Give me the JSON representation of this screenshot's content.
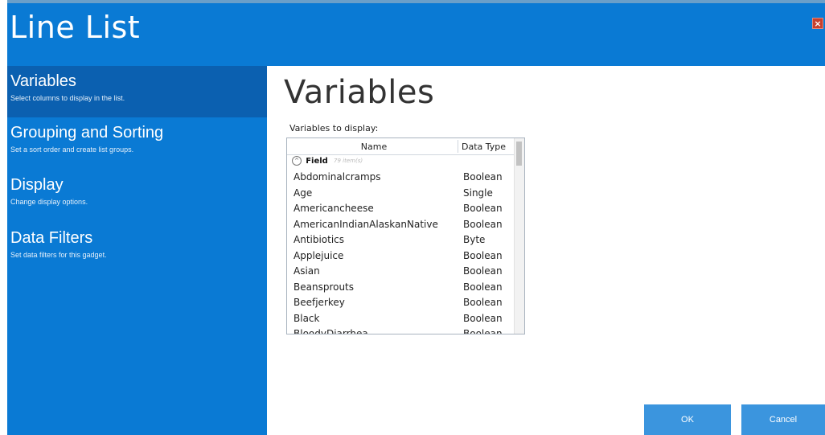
{
  "window": {
    "title": "Line List",
    "close_label": "×"
  },
  "sidebar": {
    "items": [
      {
        "title": "Variables",
        "description": "Select columns to display in the list."
      },
      {
        "title": "Grouping and Sorting",
        "description": "Set a sort order and create list groups."
      },
      {
        "title": "Display",
        "description": "Change display options."
      },
      {
        "title": "Data Filters",
        "description": "Set data filters for this gadget."
      }
    ],
    "active_index": 0
  },
  "main": {
    "heading": "Variables",
    "list_label": "Variables to display:",
    "grid": {
      "columns": [
        "Name",
        "Data Type"
      ],
      "group": {
        "icon": "collapse-icon",
        "name": "Field",
        "count": "79 item(s)"
      },
      "rows": [
        {
          "name": "Abdominalcramps",
          "type": "Boolean"
        },
        {
          "name": "Age",
          "type": "Single"
        },
        {
          "name": "Americancheese",
          "type": "Boolean"
        },
        {
          "name": "AmericanIndianAlaskanNative",
          "type": "Boolean"
        },
        {
          "name": "Antibiotics",
          "type": "Byte"
        },
        {
          "name": "Applejuice",
          "type": "Boolean"
        },
        {
          "name": "Asian",
          "type": "Boolean"
        },
        {
          "name": "Beansprouts",
          "type": "Boolean"
        },
        {
          "name": "Beefjerkey",
          "type": "Boolean"
        },
        {
          "name": "Black",
          "type": "Boolean"
        },
        {
          "name": "BloodyDiarrhea",
          "type": "Boolean"
        }
      ]
    }
  },
  "buttons": {
    "ok": "OK",
    "cancel": "Cancel"
  },
  "colors": {
    "accent": "#0a7ad4",
    "active_nav": "#0b60b0",
    "button": "#3b95de",
    "close": "#c8402d"
  }
}
